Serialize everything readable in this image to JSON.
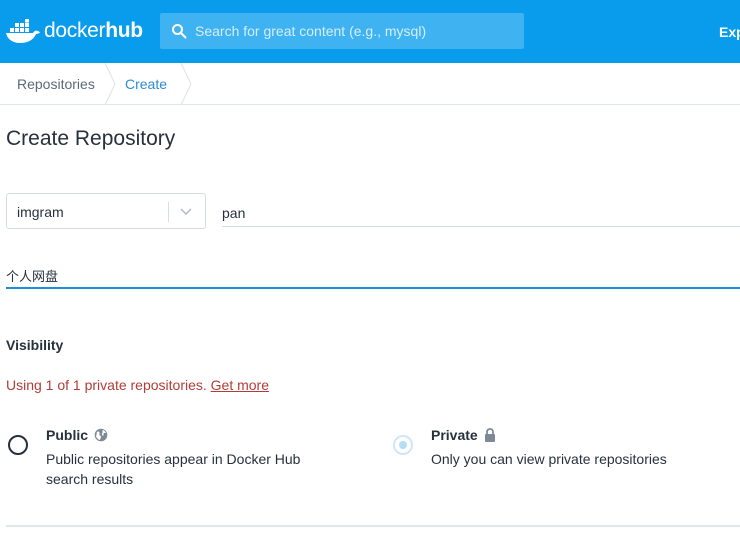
{
  "header": {
    "logo_brand": "docker",
    "logo_hub": "hub",
    "search_placeholder": "Search for great content (e.g., mysql)",
    "nav_explore": "Exp",
    "brand_color": "#099cec"
  },
  "breadcrumb": {
    "items": [
      "Repositories",
      "Create"
    ]
  },
  "page": {
    "title": "Create Repository"
  },
  "form": {
    "namespace": "imgram",
    "repo_name": "pan",
    "description": "个人网盘",
    "visibility": {
      "heading": "Visibility",
      "note": "Using 1 of 1 private repositories.",
      "note_link": "Get more",
      "options": [
        {
          "title": "Public",
          "icon": "globe-icon",
          "description": "Public repositories appear in Docker Hub search results",
          "selected": false
        },
        {
          "title": "Private",
          "icon": "lock-icon",
          "description": "Only you can view private repositories",
          "selected": true
        }
      ]
    }
  }
}
